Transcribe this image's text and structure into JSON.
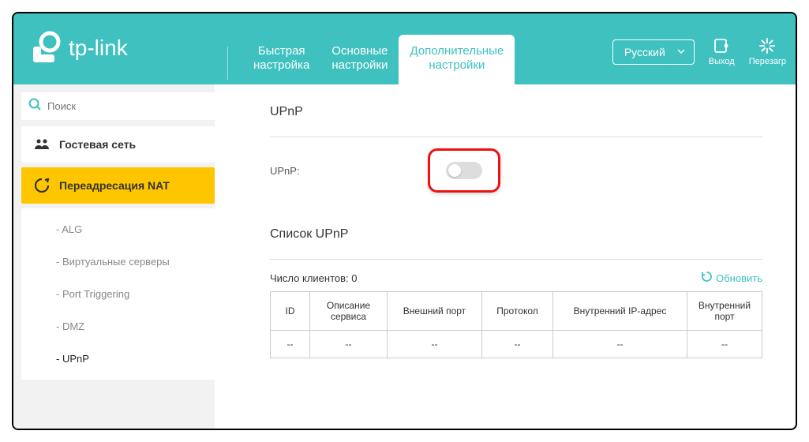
{
  "logo_text": "tp-link",
  "header": {
    "tabs": [
      {
        "label": "Быстрая\nнастройка"
      },
      {
        "label": "Основные\nнастройки"
      },
      {
        "label": "Дополнительные\nнастройки"
      }
    ],
    "language": "Русский",
    "logout": "Выход",
    "reload": "Перезагр"
  },
  "search": {
    "placeholder": "Поиск"
  },
  "sidebar": {
    "guest": "Гостевая сеть",
    "nat": "Переадресация NAT",
    "subs": [
      "- ALG",
      "- Виртуальные серверы",
      "- Port Triggering",
      "- DMZ",
      "- UPnP"
    ]
  },
  "upnp": {
    "title": "UPnP",
    "label": "UPnP:",
    "list_title": "Список UPnP",
    "clients_prefix": "Число клиентов:",
    "clients_count": "0",
    "refresh": "Обновить",
    "columns": [
      "ID",
      "Описание сервиса",
      "Внешний порт",
      "Протокол",
      "Внутренний IP-адрес",
      "Внутренний порт"
    ],
    "empty": [
      "--",
      "--",
      "--",
      "--",
      "--",
      "--"
    ]
  }
}
